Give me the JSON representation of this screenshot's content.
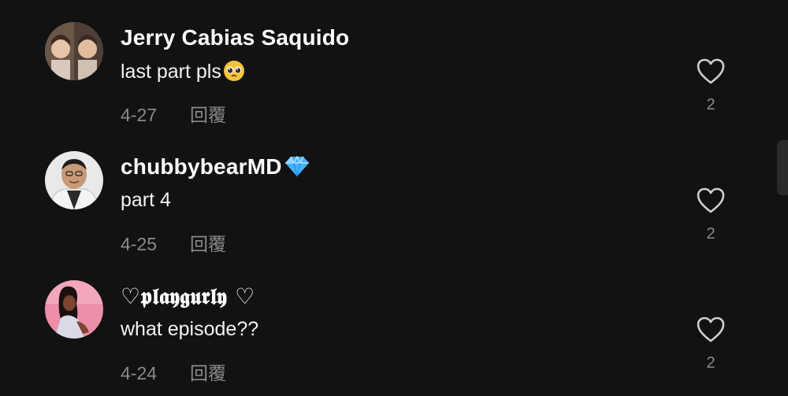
{
  "comments": [
    {
      "username": "Jerry Cabias Saquido",
      "text": "last part pls",
      "emoji": "pleading-face",
      "date": "4-27",
      "reply_label": "回覆",
      "likes": "2"
    },
    {
      "username": "chubbybearMD",
      "badge": "gem",
      "text": "part 4",
      "date": "4-25",
      "reply_label": "回覆",
      "likes": "2"
    },
    {
      "username": "♡𝖕𝖑𝖆𝖞𝖌𝖚𝖗𝖑𝖞 ♡",
      "text": "what episode??",
      "date": "4-24",
      "reply_label": "回覆",
      "likes": "2"
    }
  ],
  "colors": {
    "background": "#121212",
    "text_primary": "#ffffff",
    "text_secondary": "#8a8a8a"
  }
}
